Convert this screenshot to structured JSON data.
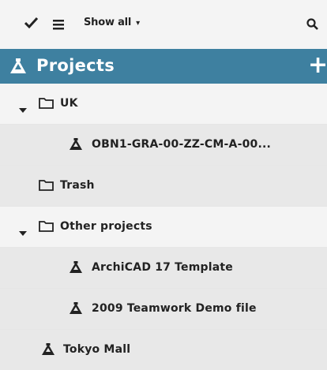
{
  "toolbar": {
    "check_icon": "checkmark-icon",
    "list_icon": "list-icon",
    "show_all_label": "Show all",
    "caret": "▾",
    "search_icon": "search-icon"
  },
  "header": {
    "title": "Projects",
    "add_label": "+",
    "background": "#3e80a0"
  },
  "tree": [
    {
      "label": "UK",
      "type": "folder",
      "expanded": true
    },
    {
      "label": "OBN1-GRA-00-ZZ-CM-A-00...",
      "type": "project"
    },
    {
      "label": "Trash",
      "type": "folder"
    },
    {
      "label": "Other projects",
      "type": "folder",
      "expanded": true
    },
    {
      "label": "ArchiCAD 17 Template",
      "type": "project"
    },
    {
      "label": "2009 Teamwork Demo file",
      "type": "project"
    },
    {
      "label": "Tokyo Mall",
      "type": "project"
    }
  ]
}
